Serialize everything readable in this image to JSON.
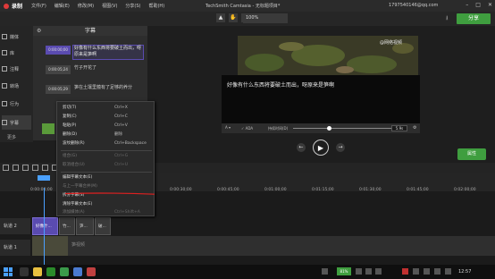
{
  "titlebar": {
    "record_label": "录制",
    "menus": [
      "文件(F)",
      "编辑(E)",
      "修改(M)",
      "视图(V)",
      "分享(S)",
      "帮助(H)"
    ],
    "app_title": "TechSmith Camtasia - 无标题项目*",
    "account": "1797540146@qq.com"
  },
  "toolbar": {
    "zoom": "100%",
    "share_label": "分享"
  },
  "rail": {
    "items": [
      "媒体",
      "库",
      "注释",
      "转场",
      "行为",
      "字幕"
    ],
    "more_label": "更多"
  },
  "subtitle_panel": {
    "title": "字幕",
    "rows": [
      {
        "time": "0:00:00;00",
        "text": "好像有什么东西将要破土而出，呀原来是笋啊"
      },
      {
        "time": "0:00:05;24",
        "text": "竹子开花了"
      },
      {
        "time": "0:00:05;29",
        "text": "笋在土壤里蕴有了足够的养分"
      }
    ]
  },
  "preview": {
    "watermark": "@网络视频",
    "caption": "好像有什么东西将要破土而出，呀原来是笋啊"
  },
  "caption_bar": {
    "ada_label": "✓ ADA",
    "duration_label": "持续时间(D)",
    "duration_value": "5.9s"
  },
  "properties_label": "属性",
  "context_menu": {
    "items": [
      {
        "label": "剪切(T)",
        "key": "Ctrl+X",
        "enabled": true
      },
      {
        "label": "复制(C)",
        "key": "Ctrl+C",
        "enabled": true
      },
      {
        "label": "粘贴(P)",
        "key": "Ctrl+V",
        "enabled": true
      },
      {
        "label": "删除(D)",
        "key": "删除",
        "enabled": true
      },
      {
        "label": "波纹删除(R)",
        "key": "Ctrl+Backspace",
        "enabled": true
      },
      {
        "label": "组合(G)",
        "key": "Ctrl+G",
        "enabled": false
      },
      {
        "label": "取消组合(U)",
        "key": "Ctrl+U",
        "enabled": false
      },
      {
        "label": "编辑字幕文本(E)",
        "key": "",
        "enabled": true
      },
      {
        "label": "与上一字幕合并(M)",
        "key": "",
        "enabled": false
      },
      {
        "label": "拆分字幕(S)",
        "key": "",
        "enabled": true
      },
      {
        "label": "清除字幕文本(E)",
        "key": "",
        "enabled": true
      },
      {
        "label": "添加媒体(A)",
        "key": "Ctrl+Shift+A",
        "enabled": false
      }
    ]
  },
  "timeline": {
    "ticks": [
      "0:00:00;00",
      "0:00:15;00",
      "0:00:30;00",
      "0:00:45;00",
      "0:01:00;00",
      "0:01:15;00",
      "0:01:30;00",
      "0:01:45;00",
      "0:02:00;00"
    ],
    "track2_label": "轨道 2",
    "track1_label": "轨道 1",
    "clips": [
      "好像什...",
      "竹...",
      "笋...",
      "破..."
    ],
    "video_clip": "笋视频"
  },
  "taskbar": {
    "battery": "81%",
    "clock": "12:57"
  },
  "colors": {
    "accent_green": "#3f9e3f",
    "selection_purple": "#5a4bb0",
    "playhead_blue": "#4aa0ff"
  }
}
